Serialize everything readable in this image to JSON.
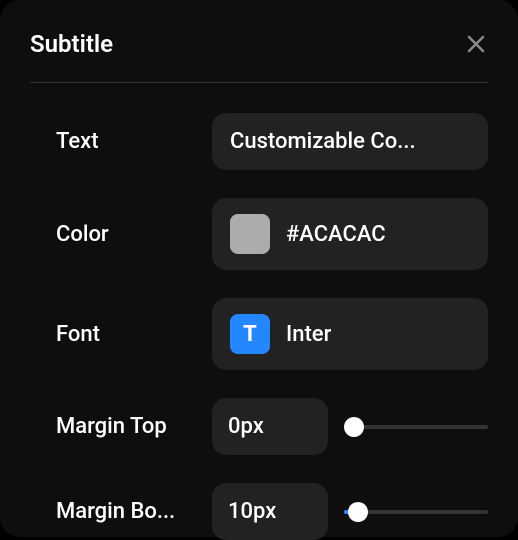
{
  "panel": {
    "title": "Subtitle"
  },
  "fields": {
    "text": {
      "label": "Text",
      "value": "Customizable Co..."
    },
    "color": {
      "label": "Color",
      "hex": "#ACACAC"
    },
    "font": {
      "label": "Font",
      "value": "Inter",
      "icon_letter": "T"
    },
    "marginTop": {
      "label": "Margin Top",
      "value": "0px",
      "slider_percent": 0
    },
    "marginBottom": {
      "label": "Margin Bo...",
      "value": "10px",
      "slider_percent": 10
    }
  },
  "colors": {
    "accent": "#2388ff",
    "swatch": "#ACACAC"
  }
}
